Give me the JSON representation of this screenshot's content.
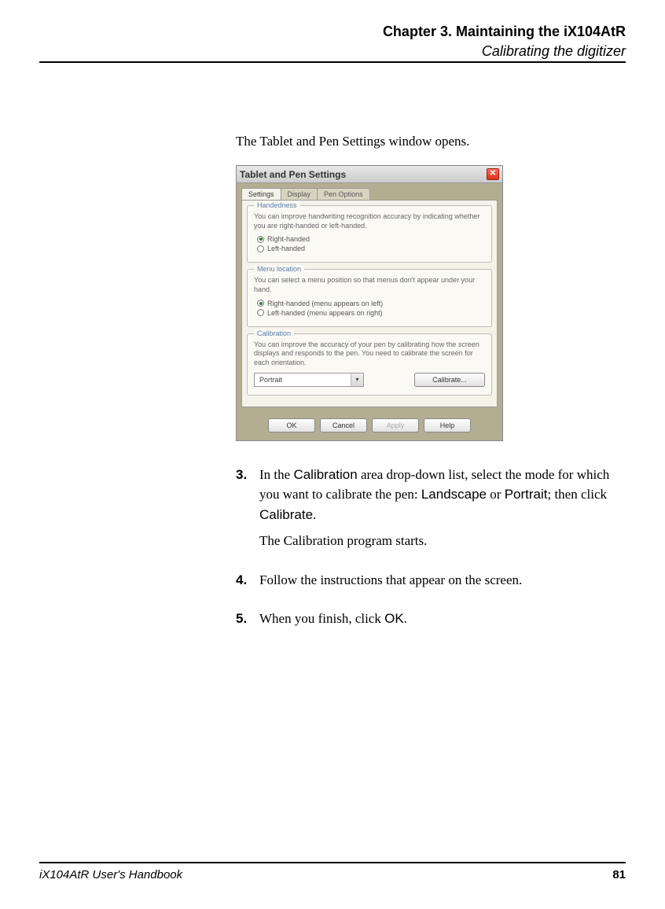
{
  "header": {
    "chapter": "Chapter 3. Maintaining the iX104AtR",
    "section": "Calibrating the digitizer"
  },
  "intro": "The Tablet and Pen Settings window opens.",
  "dialog": {
    "title": "Tablet and Pen Settings",
    "tabs": {
      "t1": "Settings",
      "t2": "Display",
      "t3": "Pen Options"
    },
    "handedness": {
      "title": "Handedness",
      "desc": "You can improve handwriting recognition accuracy by indicating whether you are right-handed or left-handed.",
      "opt1": "Right-handed",
      "opt2": "Left-handed"
    },
    "menu": {
      "title": "Menu location",
      "desc": "You can select a menu position so that menus don't appear under your hand.",
      "opt1": "Right-handed (menu appears on left)",
      "opt2": "Left-handed (menu appears on right)"
    },
    "calibration": {
      "title": "Calibration",
      "desc": "You can improve the accuracy of your pen by calibrating how the screen displays and responds to the pen. You need to calibrate the screen for each orientation.",
      "dropdown": "Portrait",
      "button": "Calibrate..."
    },
    "buttons": {
      "ok": "OK",
      "cancel": "Cancel",
      "apply": "Apply",
      "help": "Help"
    }
  },
  "steps": {
    "s3": {
      "num": "3.",
      "p1a": "In the ",
      "p1b": "Calibration",
      "p1c": " area drop-down list, select the mode for which you want to calibrate the pen: ",
      "p1d": "Landscape",
      "p1e": " or ",
      "p1f": "Portrait",
      "p1g": "; then click ",
      "p1h": "Calibrate",
      "p1i": ".",
      "p2": "The Calibration program starts."
    },
    "s4": {
      "num": "4.",
      "text": "Follow the instructions that appear on the screen."
    },
    "s5": {
      "num": "5.",
      "t1": "When you finish, click ",
      "t2": "OK",
      "t3": "."
    }
  },
  "footer": {
    "book": "iX104AtR User's Handbook",
    "page": "81"
  }
}
